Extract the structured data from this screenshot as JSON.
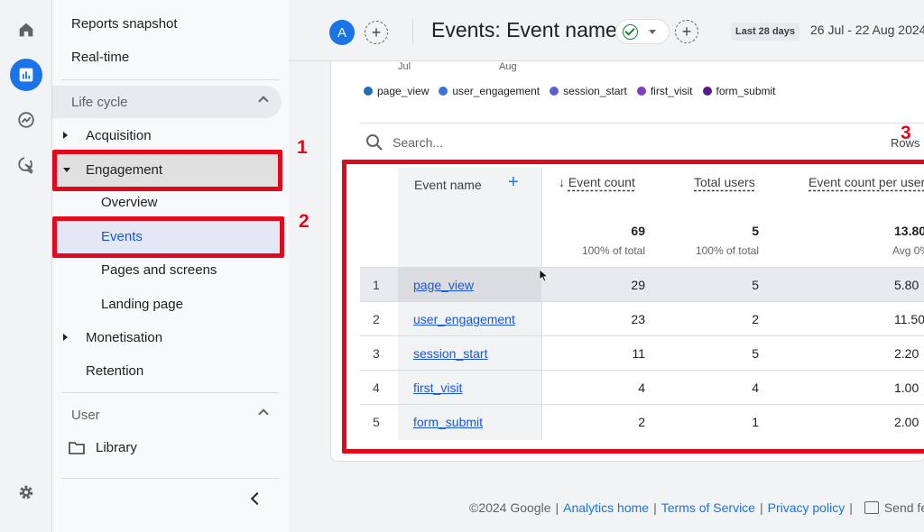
{
  "nav": {
    "reports_snapshot": "Reports snapshot",
    "realtime": "Real-time",
    "lifecycle_header": "Life cycle",
    "acquisition": "Acquisition",
    "engagement": "Engagement",
    "overview": "Overview",
    "events": "Events",
    "pages_and_screens": "Pages and screens",
    "landing_page": "Landing page",
    "monetisation": "Monetisation",
    "retention": "Retention",
    "user_header": "User",
    "library": "Library"
  },
  "annotations": [
    "1",
    "2",
    "3"
  ],
  "header": {
    "avatar_letter": "A",
    "plus": "+",
    "title": "Events: Event name",
    "date_badge": "Last 28 days",
    "date_range": "26 Jul - 22 Aug 2024"
  },
  "chart": {
    "months": [
      "Jul",
      "Aug"
    ],
    "legend": [
      {
        "label": "page_view",
        "color": "#1e6fb5"
      },
      {
        "label": "user_engagement",
        "color": "#3b73d9"
      },
      {
        "label": "session_start",
        "color": "#5b5fd6"
      },
      {
        "label": "first_visit",
        "color": "#7b3fc8"
      },
      {
        "label": "form_submit",
        "color": "#5a1a8c"
      }
    ]
  },
  "search": {
    "placeholder": "Search..."
  },
  "rows_per_page_label": "Rows",
  "table": {
    "headers": {
      "event_name": "Event name",
      "event_count": "Event count",
      "total_users": "Total users",
      "event_count_per_user": "Event count per user"
    },
    "totals": {
      "event_count": "69",
      "event_count_sub": "100% of total",
      "total_users": "5",
      "total_users_sub": "100% of total",
      "per_user": "13.80",
      "per_user_sub": "Avg 0%"
    },
    "rows": [
      {
        "idx": "1",
        "name": "page_view",
        "count": "29",
        "users": "5",
        "per_user": "5.80"
      },
      {
        "idx": "2",
        "name": "user_engagement",
        "count": "23",
        "users": "2",
        "per_user": "11.50"
      },
      {
        "idx": "3",
        "name": "session_start",
        "count": "11",
        "users": "5",
        "per_user": "2.20"
      },
      {
        "idx": "4",
        "name": "first_visit",
        "count": "4",
        "users": "4",
        "per_user": "1.00"
      },
      {
        "idx": "5",
        "name": "form_submit",
        "count": "2",
        "users": "1",
        "per_user": "2.00"
      }
    ]
  },
  "footer": {
    "copyright": "©2024 Google",
    "analytics_home": "Analytics home",
    "terms": "Terms of Service",
    "privacy": "Privacy policy",
    "feedback": "Send feedback"
  }
}
